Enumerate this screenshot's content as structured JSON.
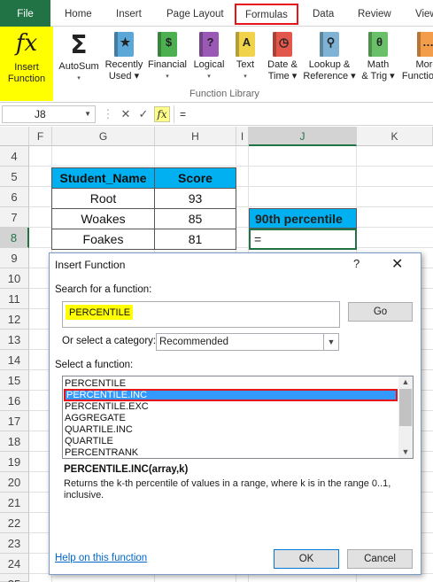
{
  "ribbon_tabs": {
    "file": "File",
    "home": "Home",
    "insert": "Insert",
    "page_layout": "Page Layout",
    "formulas": "Formulas",
    "data": "Data",
    "review": "Review",
    "view": "View"
  },
  "ribbon": {
    "insert_function": {
      "icon": "fx",
      "line1": "Insert",
      "line2": "Function"
    },
    "buttons": [
      {
        "line1": "AutoSum",
        "line2": "▾",
        "icon": "sigma-icon"
      },
      {
        "line1": "Recently",
        "line2": "Used ▾",
        "icon": "star-book-icon"
      },
      {
        "line1": "Financial",
        "line2": "▾",
        "icon": "dollar-book-icon"
      },
      {
        "line1": "Logical",
        "line2": "▾",
        "icon": "question-book-icon"
      },
      {
        "line1": "Text",
        "line2": "▾",
        "icon": "text-book-icon"
      },
      {
        "line1": "Date &",
        "line2": "Time ▾",
        "icon": "clock-book-icon"
      },
      {
        "line1": "Lookup &",
        "line2": "Reference ▾",
        "icon": "magnifier-book-icon"
      },
      {
        "line1": "Math",
        "line2": "& Trig ▾",
        "icon": "theta-book-icon"
      },
      {
        "line1": "More",
        "line2": "Functions ▾",
        "icon": "more-book-icon"
      }
    ],
    "group_label": "Function Library"
  },
  "formula_bar": {
    "name_box": "J8",
    "cancel_icon": "✕",
    "enter_icon": "✓",
    "fx": "fx",
    "content": "="
  },
  "grid": {
    "columns": [
      "F",
      "G",
      "H",
      "I",
      "J",
      "K"
    ],
    "selected_column": "J",
    "rows": [
      "4",
      "5",
      "6",
      "7",
      "8",
      "9",
      "10",
      "11",
      "12",
      "13",
      "14",
      "15",
      "16",
      "17",
      "18",
      "19",
      "20",
      "21",
      "22",
      "23",
      "24",
      "25"
    ],
    "selected_row": "8",
    "table": {
      "headers": [
        "Student_Name",
        "Score"
      ],
      "rows": [
        [
          "Root",
          "93"
        ],
        [
          "Woakes",
          "85"
        ],
        [
          "Foakes",
          "81"
        ]
      ]
    },
    "percentile_header": "90th percentile",
    "active_cell_value": "="
  },
  "dialog": {
    "title": "Insert Function",
    "help": "?",
    "close": "✕",
    "search_label": "Search for a function:",
    "search_value": "PERCENTILE",
    "go": "Go",
    "category_label": "Or select a category:",
    "category_value": "Recommended",
    "select_label": "Select a function:",
    "functions": [
      "PERCENTILE",
      "PERCENTILE.INC",
      "PERCENTILE.EXC",
      "AGGREGATE",
      "QUARTILE.INC",
      "QUARTILE",
      "PERCENTRANK"
    ],
    "selected_function": "PERCENTILE.INC",
    "signature": "PERCENTILE.INC(array,k)",
    "description": "Returns the k-th percentile of values in a range, where k is in the range 0..1, inclusive.",
    "help_link": "Help on this function",
    "ok": "OK",
    "cancel": "Cancel"
  },
  "colors": {
    "excel_green": "#217346",
    "highlight_yellow": "#ffff00",
    "header_blue": "#00b0f0",
    "selection_blue": "#3399ff",
    "annotation_red": "#e8141b"
  }
}
